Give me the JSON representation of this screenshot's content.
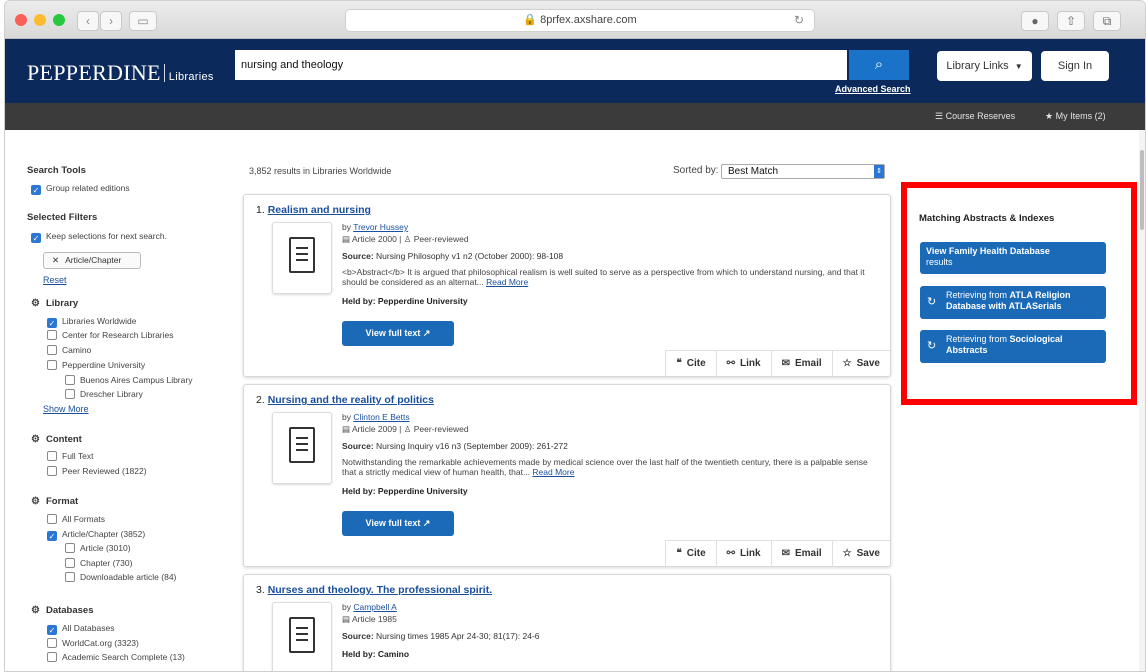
{
  "browser": {
    "url": "8prfex.axshare.com",
    "back_glyph": "‹",
    "fwd_glyph": "›",
    "reload_glyph": "↻"
  },
  "header": {
    "logo_main": "PEPPERDINE",
    "logo_sub": "Libraries",
    "search_value": "nursing and theology",
    "advanced_search": "Advanced Search",
    "library_links": "Library Links",
    "sign_in": "Sign In"
  },
  "subbar": {
    "course_reserves": "Course Reserves",
    "my_items": "My Items (2)"
  },
  "sidebar": {
    "search_tools": "Search Tools",
    "group_related": "Group related editions",
    "selected_filters": "Selected Filters",
    "keep_selections": "Keep selections for next search.",
    "chip": "Article/Chapter",
    "reset": "Reset",
    "library_heading": "Library",
    "library_items": [
      "Libraries Worldwide",
      "Center for Research Libraries",
      "Camino",
      "Pepperdine University",
      "Buenos Aires Campus Library",
      "Drescher Library"
    ],
    "show_more": "Show More",
    "content_heading": "Content",
    "content_items": [
      "Full Text",
      "Peer Reviewed (1822)"
    ],
    "format_heading": "Format",
    "format_items": [
      "All Formats",
      "Article/Chapter (3852)",
      "Article (3010)",
      "Chapter (730)",
      "Downloadable article (84)"
    ],
    "databases_heading": "Databases",
    "database_items": [
      "All Databases",
      "WorldCat.org (3323)",
      "Academic Search Complete (13)"
    ]
  },
  "results": {
    "count_text": "3,852 results in Libraries Worldwide",
    "sorted_by": "Sorted by:",
    "sort_value": "Best Match",
    "items": [
      {
        "num": "1.",
        "title": "Realism and nursing",
        "by": "by",
        "author": "Trevor Hussey",
        "type": "Article 2000 | ",
        "peer": "Peer-reviewed",
        "source_label": "Source:",
        "source": "Nursing Philosophy v1 n2 (October 2000): 98-108",
        "abstract": "<b>Abstract</b> It is argued that philosophical realism is well suited to serve as a perspective from which to understand nursing, and that it should be considered as an alternat...",
        "read_more": "Read More",
        "held_by": "Held by: Pepperdine University",
        "view_full_text": "View full text"
      },
      {
        "num": "2.",
        "title": "Nursing and the reality of politics",
        "by": "by",
        "author": "Clinton E Betts",
        "type": "Article 2009 | ",
        "peer": "Peer-reviewed",
        "source_label": "Source:",
        "source": "Nursing Inquiry v16 n3 (September 2009): 261-272",
        "abstract": "Notwithstanding the remarkable achievements made by medical science over the last half of the twentieth century, there is a palpable sense that a strictly medical view of human health, that...",
        "read_more": "Read More",
        "held_by": "Held by: Pepperdine University",
        "view_full_text": "View full text"
      },
      {
        "num": "3.",
        "title": "Nurses and theology. The professional spirit.",
        "by": "by",
        "author": "Campbell A",
        "type": "Article 1985",
        "source_label": "Source:",
        "source": "Nursing times 1985 Apr 24-30; 81(17): 24-6",
        "held_by": "Held by: Camino"
      }
    ],
    "actions": {
      "cite": "Cite",
      "link": "Link",
      "email": "Email",
      "save": "Save"
    }
  },
  "right_panel": {
    "title": "Matching Abstracts & Indexes",
    "btn1_bold": "View Family Health Database",
    "btn1_rest": "results",
    "btn2_pre": "Retrieving from ",
    "btn2_bold": "ATLA Religion Database with ATLASerials",
    "btn3_pre": "Retrieving from ",
    "btn3_bold": "Sociological Abstracts"
  },
  "colors": {
    "header_bg": "#0b2a5b",
    "accent_blue": "#1a6ab8",
    "highlight_box": "#ff0000"
  }
}
